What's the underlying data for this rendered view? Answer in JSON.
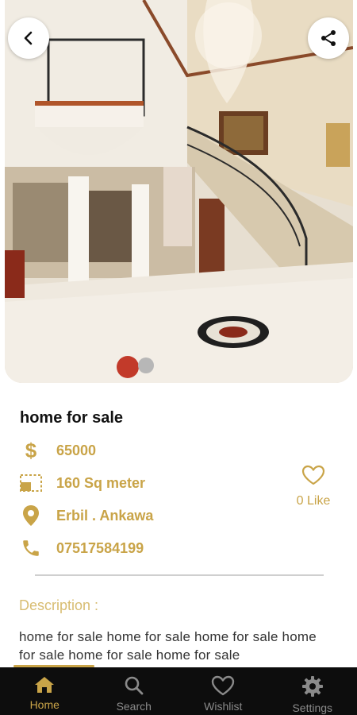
{
  "listing": {
    "title": "home for sale",
    "price": "65000",
    "area": "160 Sq meter",
    "location": "Erbil . Ankawa",
    "phone": "07517584199",
    "likes": "0 Like"
  },
  "description": {
    "label": "Description :",
    "text": "home for sale home for sale home for sale home for sale home for sale home for sale"
  },
  "nav": {
    "items": [
      {
        "label": "Home",
        "icon": "home-icon",
        "active": true
      },
      {
        "label": "Search",
        "icon": "search-icon",
        "active": false
      },
      {
        "label": "Wishlist",
        "icon": "heart-icon",
        "active": false
      },
      {
        "label": "Settings",
        "icon": "gear-icon",
        "active": false
      }
    ]
  },
  "colors": {
    "accent": "#c9a448",
    "nav_bg": "#0d0d0d",
    "nav_inactive": "#8a8a8a",
    "title": "#111111"
  }
}
